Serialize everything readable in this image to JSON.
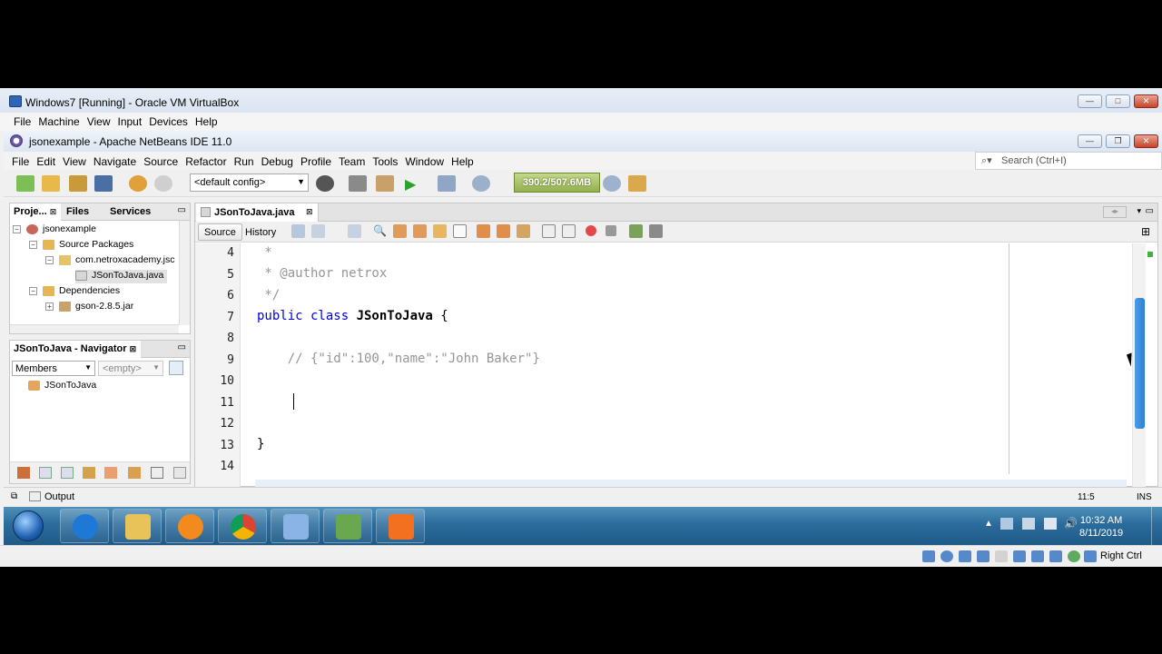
{
  "vbox": {
    "title": "Windows7 [Running] - Oracle VM VirtualBox",
    "menu": [
      "File",
      "Machine",
      "View",
      "Input",
      "Devices",
      "Help"
    ],
    "host_key": "Right Ctrl"
  },
  "netbeans": {
    "title": "jsonexample - Apache NetBeans IDE 11.0",
    "menu": [
      "File",
      "Edit",
      "View",
      "Navigate",
      "Source",
      "Refactor",
      "Run",
      "Debug",
      "Profile",
      "Team",
      "Tools",
      "Window",
      "Help"
    ],
    "search_placeholder": "Search (Ctrl+I)",
    "config_select": "<default config>",
    "memory": "390.2/507.6MB"
  },
  "projects_panel": {
    "tabs": [
      "Proje...",
      "Files",
      "Services"
    ],
    "tree": [
      {
        "label": "jsonexample"
      },
      {
        "label": "Source Packages"
      },
      {
        "label": "com.netroxacademy.jsc"
      },
      {
        "label": "JSonToJava.java"
      },
      {
        "label": "Dependencies"
      },
      {
        "label": "gson-2.8.5.jar"
      }
    ]
  },
  "navigator": {
    "title": "JSonToJava - Navigator",
    "members_select": "Members",
    "filter_select": "<empty>",
    "tree": [
      {
        "label": "JSonToJava"
      }
    ]
  },
  "editor": {
    "tab_label": "JSonToJava.java",
    "source_btn": "Source",
    "history_btn": "History",
    "lines": [
      {
        "num": "4",
        "text": " *"
      },
      {
        "num": "5",
        "text": " * @author netrox"
      },
      {
        "num": "6",
        "text": " */"
      },
      {
        "num": "7",
        "kw": "public class ",
        "cls": "JSonToJava",
        "rest": " {"
      },
      {
        "num": "8",
        "text": ""
      },
      {
        "num": "9",
        "text": "    // {\"id\":100,\"name\":\"John Baker\"}"
      },
      {
        "num": "10",
        "text": ""
      },
      {
        "num": "11",
        "text": ""
      },
      {
        "num": "12",
        "text": ""
      },
      {
        "num": "13",
        "text": "}"
      },
      {
        "num": "14",
        "text": ""
      }
    ]
  },
  "output_panel": {
    "label": "Output"
  },
  "status": {
    "position": "11:5",
    "mode": "INS"
  },
  "taskbar": {
    "time": "10:32 AM",
    "date": "8/11/2019",
    "apps": [
      {
        "icon": "ie-icon",
        "color": "#1e78d6"
      },
      {
        "icon": "explorer-icon",
        "color": "#e7c35a"
      },
      {
        "icon": "media-player-icon",
        "color": "#f28a1d"
      },
      {
        "icon": "chrome-icon",
        "color": "#db4437"
      },
      {
        "icon": "netbeans-icon",
        "color": "#8ab4e6"
      },
      {
        "icon": "notepad-icon",
        "color": "#6aa84f"
      },
      {
        "icon": "xampp-icon",
        "color": "#f37021"
      }
    ]
  }
}
